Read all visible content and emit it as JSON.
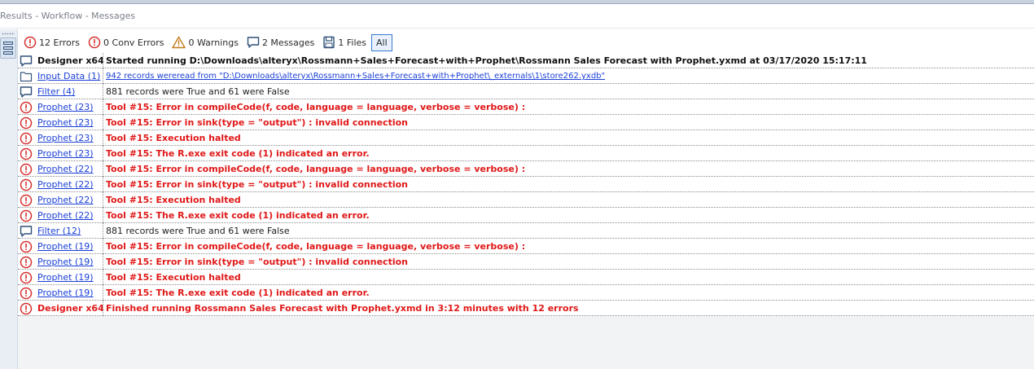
{
  "panel": {
    "title": "Results - Workflow - Messages"
  },
  "filters": [
    {
      "icon": "error-icon",
      "label": "12 Errors"
    },
    {
      "icon": "conv-error-icon",
      "label": "0 Conv Errors"
    },
    {
      "icon": "warning-icon",
      "label": "0 Warnings"
    },
    {
      "icon": "message-icon",
      "label": "2 Messages"
    },
    {
      "icon": "file-icon",
      "label": "1 Files"
    },
    {
      "icon": "",
      "label": "All",
      "active": true
    }
  ],
  "colors": {
    "error": "#e01818",
    "link": "#1a3fd6",
    "accent": "#3a7bd5"
  },
  "messages": [
    {
      "icon": "message-icon",
      "tool": "Designer x64",
      "tool_style": "bold",
      "text": "Started running D:\\Downloads\\alteryx\\Rossmann+Sales+Forecast+with+Prophet\\Rossmann Sales Forecast with Prophet.yxmd at 03/17/2020 15:17:11",
      "text_style": "bold"
    },
    {
      "icon": "file-icon",
      "tool": "Input Data (1)",
      "tool_style": "link",
      "text": "942 records wereread from \"D:\\Downloads\\alteryx\\Rossmann+Sales+Forecast+with+Prophet\\_externals\\1\\store262.yxdb\"",
      "text_style": "link"
    },
    {
      "icon": "message-icon",
      "tool": "Filter (4)",
      "tool_style": "link",
      "text": "881 records were True and 61 were False",
      "text_style": "plain"
    },
    {
      "icon": "error-icon",
      "tool": "Prophet (23)",
      "tool_style": "link",
      "text": "Tool #15: Error in compileCode(f, code, language = language, verbose = verbose) :",
      "text_style": "err"
    },
    {
      "icon": "error-icon",
      "tool": "Prophet (23)",
      "tool_style": "link",
      "text": "Tool #15: Error in sink(type = \"output\") : invalid connection",
      "text_style": "err"
    },
    {
      "icon": "error-icon",
      "tool": "Prophet (23)",
      "tool_style": "link",
      "text": "Tool #15: Execution halted",
      "text_style": "err"
    },
    {
      "icon": "error-icon",
      "tool": "Prophet (23)",
      "tool_style": "link",
      "text": "Tool #15: The R.exe exit code (1) indicated an error.",
      "text_style": "err"
    },
    {
      "icon": "error-icon",
      "tool": "Prophet (22)",
      "tool_style": "link",
      "text": "Tool #15: Error in compileCode(f, code, language = language, verbose = verbose) :",
      "text_style": "err"
    },
    {
      "icon": "error-icon",
      "tool": "Prophet (22)",
      "tool_style": "link",
      "text": "Tool #15: Error in sink(type = \"output\") : invalid connection",
      "text_style": "err"
    },
    {
      "icon": "error-icon",
      "tool": "Prophet (22)",
      "tool_style": "link",
      "text": "Tool #15: Execution halted",
      "text_style": "err"
    },
    {
      "icon": "error-icon",
      "tool": "Prophet (22)",
      "tool_style": "link",
      "text": "Tool #15: The R.exe exit code (1) indicated an error.",
      "text_style": "err"
    },
    {
      "icon": "message-icon",
      "tool": "Filter (12)",
      "tool_style": "link",
      "text": "881 records were True and 61 were False",
      "text_style": "plain"
    },
    {
      "icon": "error-icon",
      "tool": "Prophet (19)",
      "tool_style": "link",
      "text": "Tool #15: Error in compileCode(f, code, language = language, verbose = verbose) :",
      "text_style": "err"
    },
    {
      "icon": "error-icon",
      "tool": "Prophet (19)",
      "tool_style": "link",
      "text": "Tool #15: Error in sink(type = \"output\") : invalid connection",
      "text_style": "err"
    },
    {
      "icon": "error-icon",
      "tool": "Prophet (19)",
      "tool_style": "link",
      "text": "Tool #15: Execution halted",
      "text_style": "err"
    },
    {
      "icon": "error-icon",
      "tool": "Prophet (19)",
      "tool_style": "link",
      "text": "Tool #15: The R.exe exit code (1) indicated an error.",
      "text_style": "err"
    },
    {
      "icon": "error-icon",
      "tool": "Designer x64",
      "tool_style": "bold-err",
      "text": "Finished running Rossmann Sales Forecast with Prophet.yxmd in 3:12 minutes with 12 errors",
      "text_style": "err"
    }
  ]
}
